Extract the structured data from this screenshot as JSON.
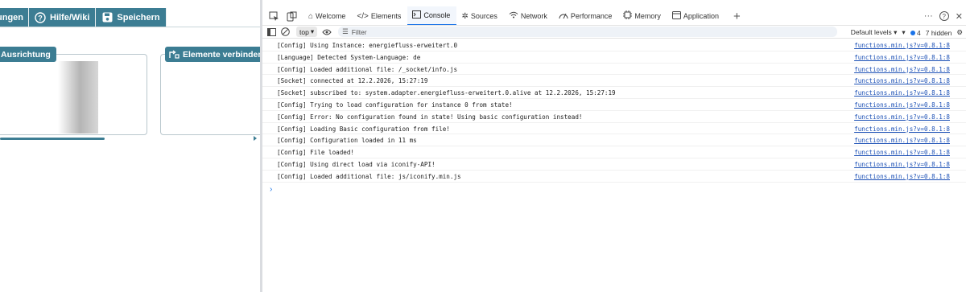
{
  "app": {
    "toolbar": [
      {
        "label": "ungen",
        "icon": "none"
      },
      {
        "label": "Hilfe/Wiki",
        "icon": "help-circle-icon"
      },
      {
        "label": "Speichern",
        "icon": "save-icon"
      }
    ],
    "panels": [
      {
        "label": "Ausrichtung"
      },
      {
        "label": "Elemente verbinden",
        "icon": "connect-icon"
      }
    ]
  },
  "devtools": {
    "tabs": [
      {
        "label": "Welcome",
        "icon": "home-icon",
        "active": false
      },
      {
        "label": "Elements",
        "icon": "code-icon",
        "active": false
      },
      {
        "label": "Console",
        "icon": "console-icon",
        "active": true
      },
      {
        "label": "Sources",
        "icon": "bug-icon",
        "active": false
      },
      {
        "label": "Network",
        "icon": "wifi-icon",
        "active": false
      },
      {
        "label": "Performance",
        "icon": "performance-icon",
        "active": false
      },
      {
        "label": "Memory",
        "icon": "memory-icon",
        "active": false
      },
      {
        "label": "Application",
        "icon": "application-icon",
        "active": false
      }
    ],
    "filter": {
      "context": "top",
      "placeholder": "Filter",
      "levels": "Default levels",
      "issues_count": "4",
      "hidden": "7 hidden"
    },
    "logs": [
      {
        "msg": "[Config] Using Instance: energiefluss-erweitert.0",
        "src": "functions.min.js?v=0.8.1:8"
      },
      {
        "msg": "[Language] Detected System-Language: de",
        "src": "functions.min.js?v=0.8.1:8"
      },
      {
        "msg": "[Config] Loaded additional file: /_socket/info.js",
        "src": "functions.min.js?v=0.8.1:8"
      },
      {
        "msg": "[Socket] connected at 12.2.2026, 15:27:19",
        "src": "functions.min.js?v=0.8.1:8"
      },
      {
        "msg": "[Socket] subscribed to: system.adapter.energiefluss-erweitert.0.alive at 12.2.2026, 15:27:19",
        "src": "functions.min.js?v=0.8.1:8"
      },
      {
        "msg": "[Config] Trying to load configuration for instance 0 from state!",
        "src": "functions.min.js?v=0.8.1:8"
      },
      {
        "msg": "[Config] Error: No configuration found in state! Using basic configuration instead!",
        "src": "functions.min.js?v=0.8.1:8"
      },
      {
        "msg": "[Config] Loading Basic configuration from file!",
        "src": "functions.min.js?v=0.8.1:8"
      },
      {
        "msg": "[Config] Configuration loaded in 11 ms",
        "src": "functions.min.js?v=0.8.1:8"
      },
      {
        "msg": "[Config] File loaded!",
        "src": "functions.min.js?v=0.8.1:8"
      },
      {
        "msg": "[Config] Using direct load via iconify-API!",
        "src": "functions.min.js?v=0.8.1:8"
      },
      {
        "msg": "[Config] Loaded additional file: js/iconify.min.js",
        "src": "functions.min.js?v=0.8.1:8"
      }
    ]
  },
  "colors": {
    "app_accent": "#3c7d93",
    "devtools_active": "#1a73e8",
    "link": "#1a4fb5"
  }
}
